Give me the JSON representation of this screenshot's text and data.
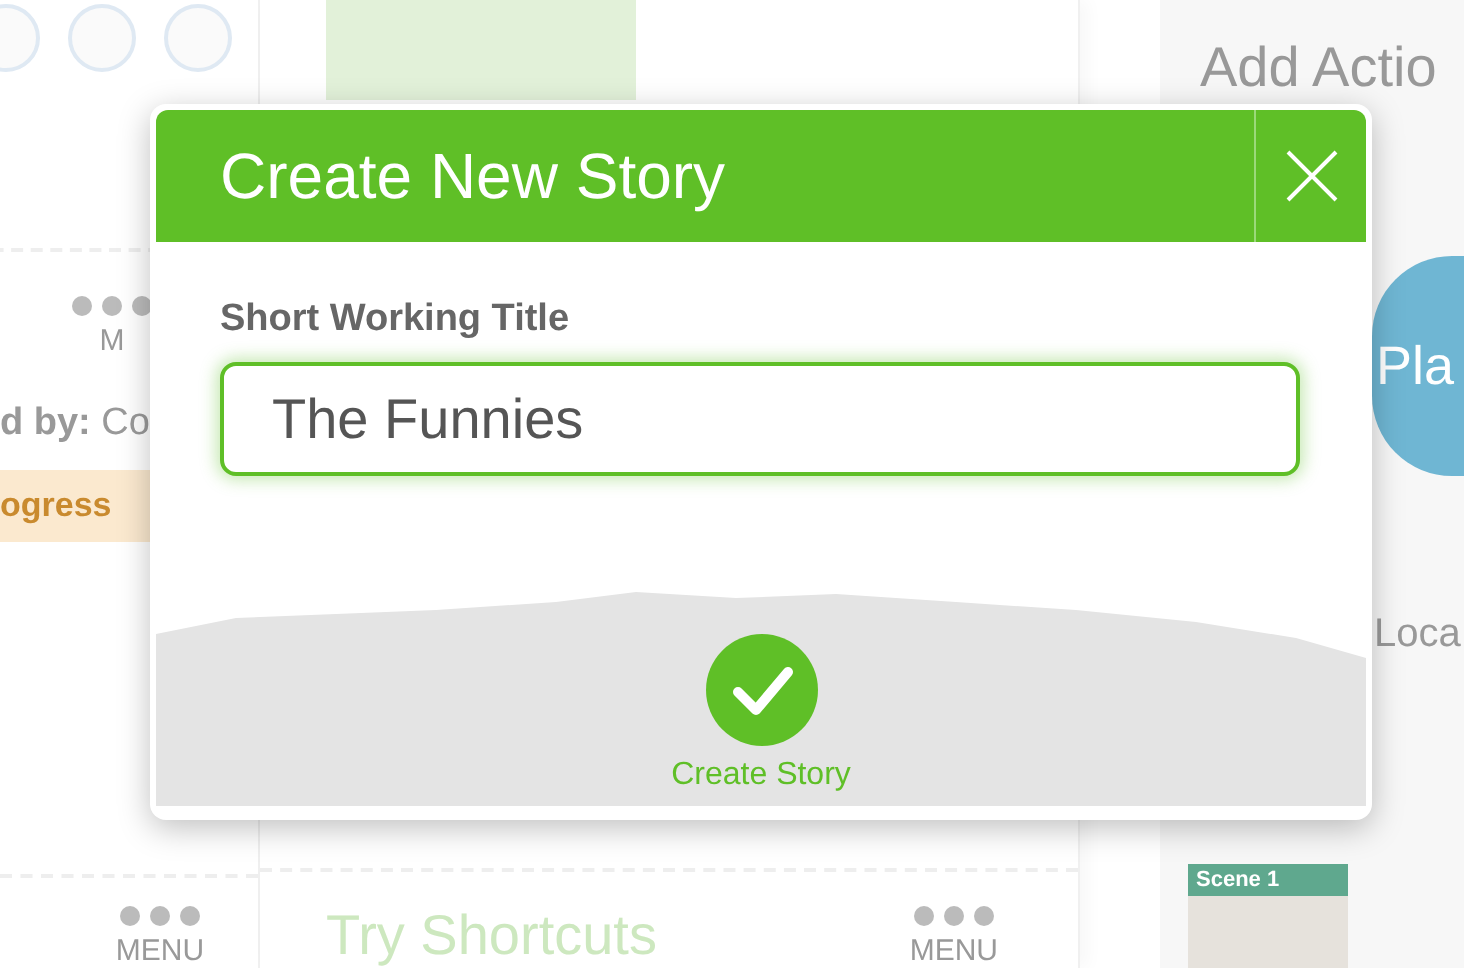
{
  "background": {
    "left_panel": {
      "menu_label": "M",
      "byline": "**d by:** Co",
      "status_badge": "ogress",
      "bottom_menu_label": "MENU"
    },
    "center_panel": {
      "bottom_link": "Try Shortcuts",
      "bottom_menu_label": "MENU"
    },
    "right_panel": {
      "title": "Add Actio",
      "play_label": "Pla",
      "location_label": "Loca",
      "scene_label": "Scene 1"
    }
  },
  "dialog": {
    "title": "Create New Story",
    "field": {
      "label": "Short Working Title",
      "value": "The Funnies",
      "focused": true
    },
    "submit_label": "Create Story"
  }
}
